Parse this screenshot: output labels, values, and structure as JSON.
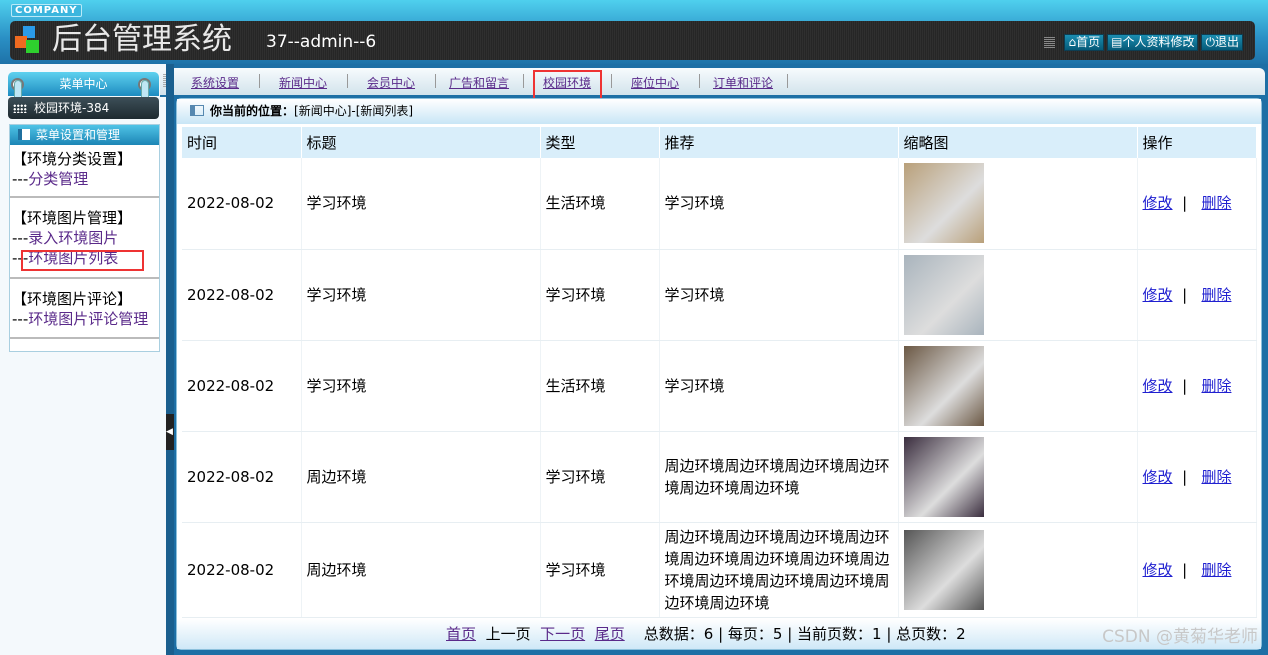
{
  "header": {
    "company": "COMPANY",
    "title": "后台管理系统",
    "user": "37--admin--6",
    "buttons": [
      {
        "icon": "home-icon",
        "label": "首页"
      },
      {
        "icon": "document-icon",
        "label": "个人资料修改"
      },
      {
        "icon": "power-icon",
        "label": "退出"
      }
    ]
  },
  "nav": {
    "items": [
      "系统设置",
      "新闻中心",
      "会员中心",
      "广告和留言",
      "校园环境",
      "座位中心",
      "订单和评论"
    ],
    "active": "校园环境"
  },
  "sidebar": {
    "menu_title": "菜单中心",
    "current_module": "校园环境-384",
    "box_title": "菜单设置和管理",
    "sections": [
      {
        "title": "【环境分类设置】",
        "links": [
          "分类管理"
        ]
      },
      {
        "title": "【环境图片管理】",
        "links": [
          "录入环境图片",
          "环境图片列表"
        ]
      },
      {
        "title": "【环境图片评论】",
        "links": [
          "环境图片评论管理"
        ]
      }
    ],
    "prefix": "---"
  },
  "breadcrumb": {
    "label": "你当前的位置：",
    "path": "[新闻中心]-[新闻列表]"
  },
  "table": {
    "headers": [
      "时间",
      "标题",
      "类型",
      "推荐",
      "缩略图",
      "操作"
    ],
    "rows": [
      {
        "date": "2022-08-02",
        "title": "学习环境",
        "type": "生活环境",
        "rec": "学习环境",
        "thumb": "#b9a07a"
      },
      {
        "date": "2022-08-02",
        "title": "学习环境",
        "type": "学习环境",
        "rec": "学习环境",
        "thumb": "#a9b4bd"
      },
      {
        "date": "2022-08-02",
        "title": "学习环境",
        "type": "生活环境",
        "rec": "学习环境",
        "thumb": "#6b5844"
      },
      {
        "date": "2022-08-02",
        "title": "周边环境",
        "type": "学习环境",
        "rec": "周边环境周边环境周边环境周边环境周边环境周边环境",
        "thumb": "#3a2d3e"
      },
      {
        "date": "2022-08-02",
        "title": "周边环境",
        "type": "学习环境",
        "rec": "周边环境周边环境周边环境周边环境周边环境周边环境周边环境周边环境周边环境周边环境周边环境周边环境周边环境",
        "thumb": "#555555"
      }
    ],
    "edit": "修改",
    "sep": "|",
    "delete": "删除"
  },
  "pager": {
    "first": "首页",
    "prev": "上一页",
    "next": "下一页",
    "last": "尾页",
    "summary": "总数据：6 | 每页：5 | 当前页数：1 | 总页数：2"
  },
  "watermark": "CSDN @黄菊华老师"
}
